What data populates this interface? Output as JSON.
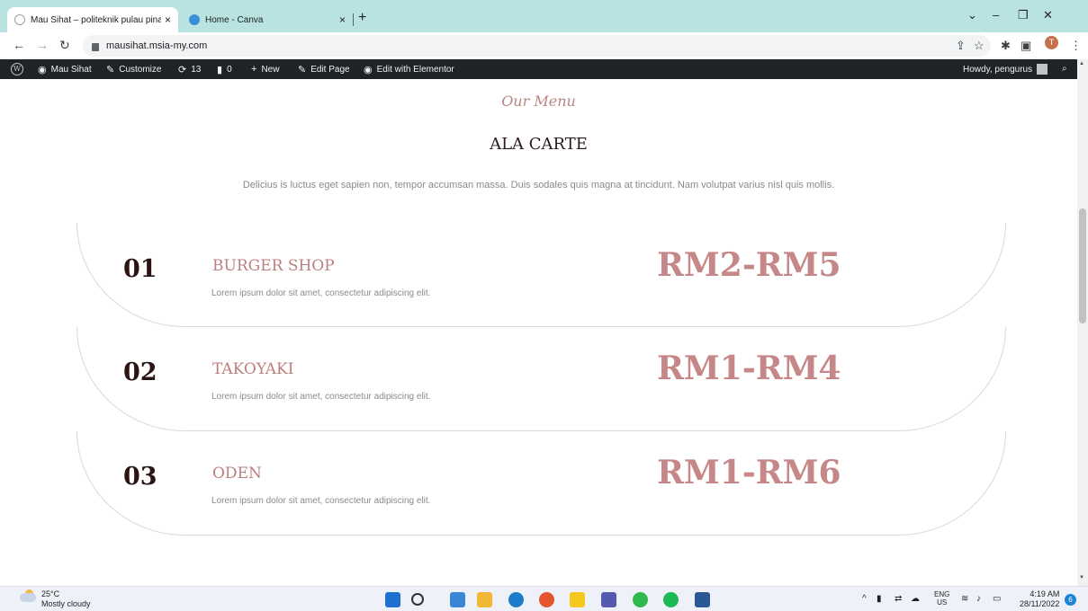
{
  "browser": {
    "tabs": [
      {
        "title": "Mau Sihat – politeknik pulau pina",
        "close": "×"
      },
      {
        "title": "Home - Canva",
        "close": "×"
      }
    ],
    "new_tab": "+",
    "url": "mausihat.msia-my.com",
    "profile_initial": "T"
  },
  "admin_bar": {
    "site_name": "Mau Sihat",
    "customize": "Customize",
    "updates_count": "13",
    "comments_count": "0",
    "new": "New",
    "edit_page": "Edit Page",
    "edit_elementor": "Edit with Elementor",
    "greeting": "Howdy, pengurus"
  },
  "page": {
    "script_title": "Our Menu",
    "section_title": "ALA CARTE",
    "intro": "Delicius is luctus eget sapien non, tempor accumsan massa. Duis sodales quis magna at tincidunt. Nam volutpat varius nisl quis mollis.",
    "menu_items": [
      {
        "number": "01",
        "name": "BURGER SHOP",
        "description": "Lorem ipsum dolor sit amet, consectetur adipiscing elit.",
        "price": "RM2-RM5"
      },
      {
        "number": "02",
        "name": "TAKOYAKI",
        "description": "Lorem ipsum dolor sit amet, consectetur adipiscing elit.",
        "price": "RM1-RM4"
      },
      {
        "number": "03",
        "name": "ODEN",
        "description": "Lorem ipsum dolor sit amet, consectetur adipiscing elit.",
        "price": "RM1-RM6"
      }
    ]
  },
  "taskbar": {
    "temperature": "25°C",
    "weather": "Mostly cloudy",
    "language": "ENG",
    "region": "US",
    "time": "4:19 AM",
    "date": "28/11/2022",
    "notification_count": "6"
  },
  "colors": {
    "accent": "#c58787",
    "heading": "#2b1a1a",
    "admin_bar": "#1d2327",
    "tab_strip": "#b8e3e1"
  }
}
